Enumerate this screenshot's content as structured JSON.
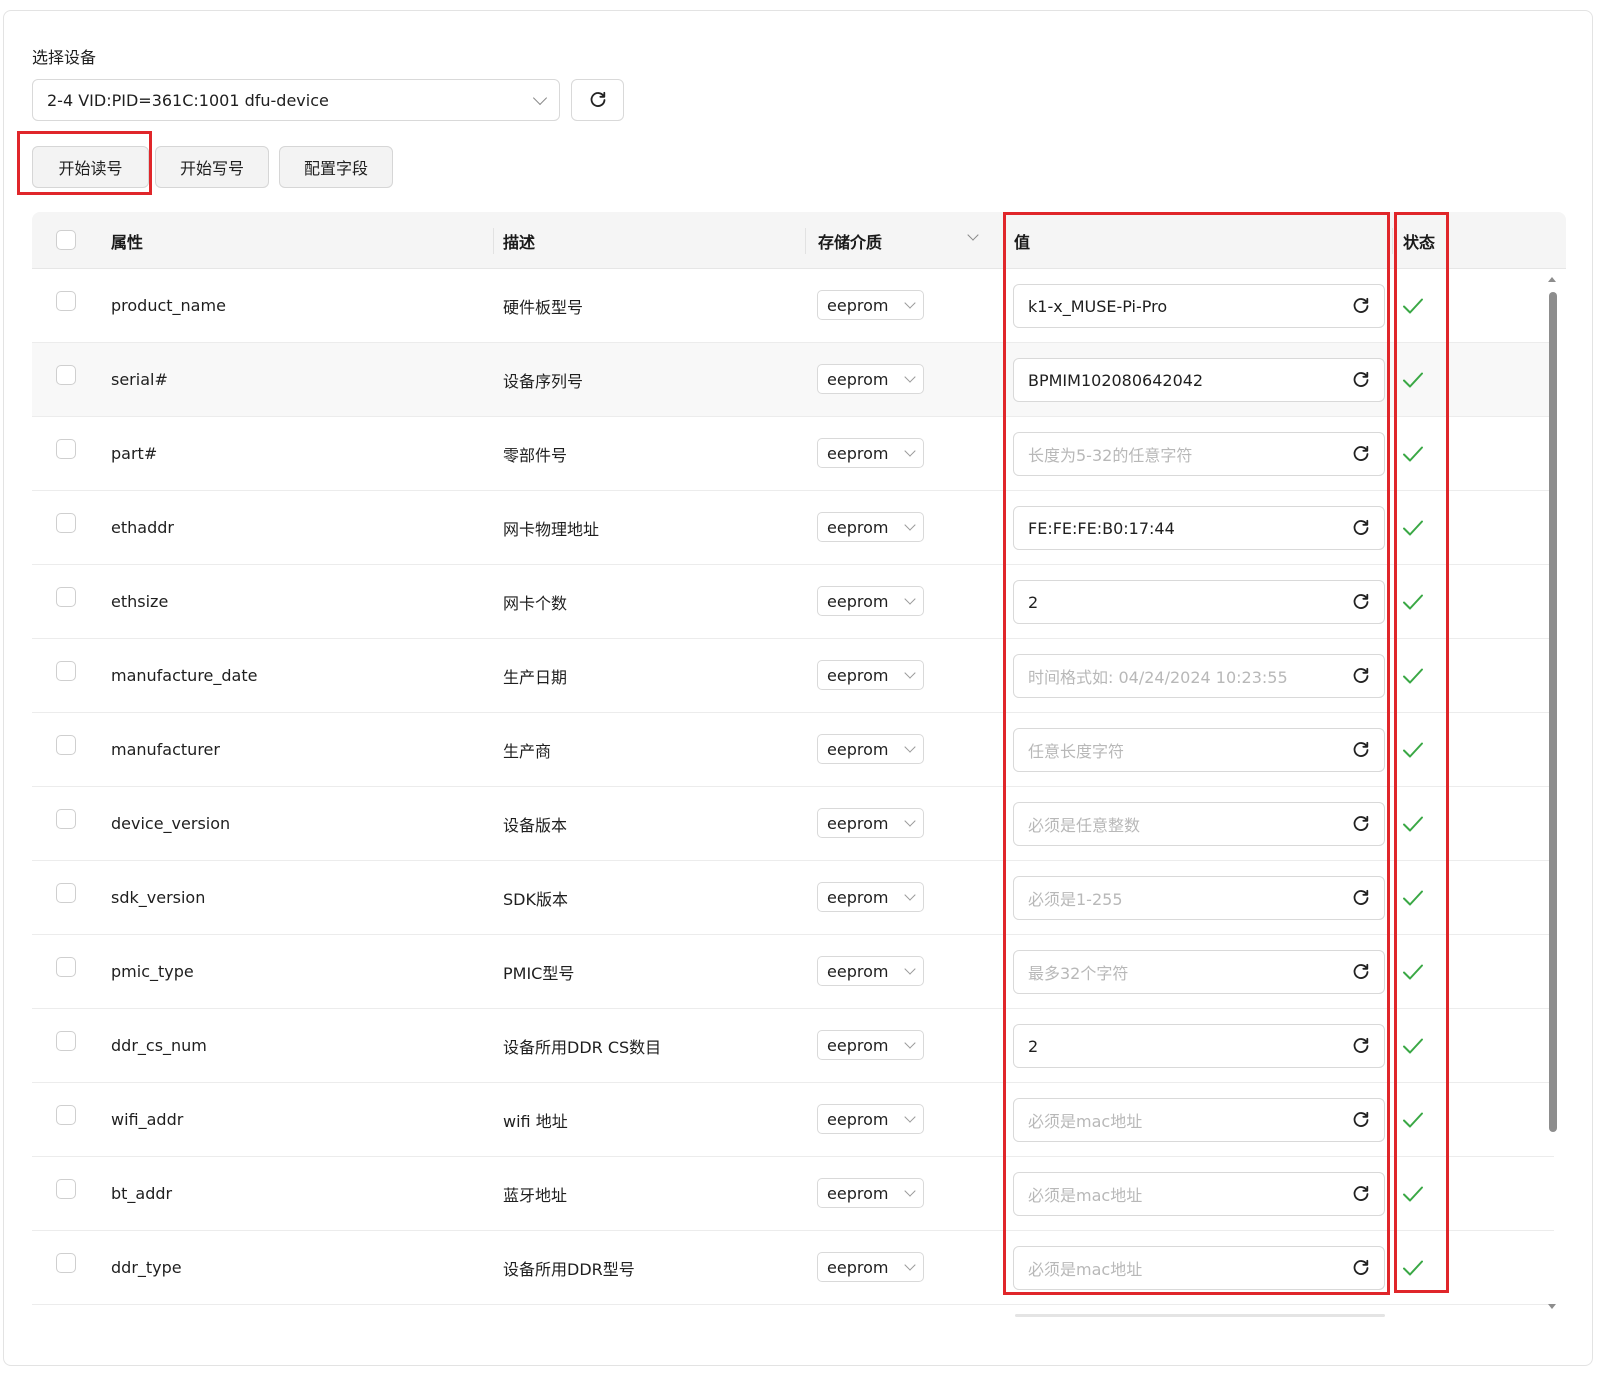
{
  "device": {
    "label": "选择设备",
    "selected": "2-4 VID:PID=361C:1001 dfu-device"
  },
  "actions": {
    "read_label": "开始读号",
    "write_label": "开始写号",
    "config_label": "配置字段"
  },
  "table": {
    "headers": {
      "attribute": "属性",
      "description": "描述",
      "media": "存储介质",
      "value": "值",
      "status": "状态"
    },
    "rows": [
      {
        "attr": "product_name",
        "desc": "硬件板型号",
        "media": "eeprom",
        "value": "k1-x_MUSE-Pi-Pro",
        "placeholder": "",
        "status": "ok"
      },
      {
        "attr": "serial#",
        "desc": "设备序列号",
        "media": "eeprom",
        "value": "BPMIM102080642042",
        "placeholder": "",
        "status": "ok"
      },
      {
        "attr": "part#",
        "desc": "零部件号",
        "media": "eeprom",
        "value": "",
        "placeholder": "长度为5-32的任意字符",
        "status": "ok"
      },
      {
        "attr": "ethaddr",
        "desc": "网卡物理地址",
        "media": "eeprom",
        "value": "FE:FE:FE:B0:17:44",
        "placeholder": "",
        "status": "ok"
      },
      {
        "attr": "ethsize",
        "desc": "网卡个数",
        "media": "eeprom",
        "value": "2",
        "placeholder": "",
        "status": "ok"
      },
      {
        "attr": "manufacture_date",
        "desc": "生产日期",
        "media": "eeprom",
        "value": "",
        "placeholder": "时间格式如: 04/24/2024 10:23:55",
        "status": "ok"
      },
      {
        "attr": "manufacturer",
        "desc": "生产商",
        "media": "eeprom",
        "value": "",
        "placeholder": "任意长度字符",
        "status": "ok"
      },
      {
        "attr": "device_version",
        "desc": "设备版本",
        "media": "eeprom",
        "value": "",
        "placeholder": "必须是任意整数",
        "status": "ok"
      },
      {
        "attr": "sdk_version",
        "desc": "SDK版本",
        "media": "eeprom",
        "value": "",
        "placeholder": "必须是1-255",
        "status": "ok"
      },
      {
        "attr": "pmic_type",
        "desc": "PMIC型号",
        "media": "eeprom",
        "value": "",
        "placeholder": "最多32个字符",
        "status": "ok"
      },
      {
        "attr": "ddr_cs_num",
        "desc": "设备所用DDR CS数目",
        "media": "eeprom",
        "value": "2",
        "placeholder": "",
        "status": "ok"
      },
      {
        "attr": "wifi_addr",
        "desc": "wifi 地址",
        "media": "eeprom",
        "value": "",
        "placeholder": "必须是mac地址",
        "status": "ok"
      },
      {
        "attr": "bt_addr",
        "desc": "蓝牙地址",
        "media": "eeprom",
        "value": "",
        "placeholder": "必须是mac地址",
        "status": "ok"
      },
      {
        "attr": "ddr_type",
        "desc": "设备所用DDR型号",
        "media": "eeprom",
        "value": "",
        "placeholder": "必须是mac地址",
        "status": "ok"
      }
    ]
  },
  "colors": {
    "highlight": "#e0262a",
    "check": "#3aa845",
    "placeholder": "#b8b8b8"
  },
  "icons": {
    "refresh": "refresh-icon",
    "status_ok": "check-icon",
    "dropdown": "chevron-down-icon"
  }
}
